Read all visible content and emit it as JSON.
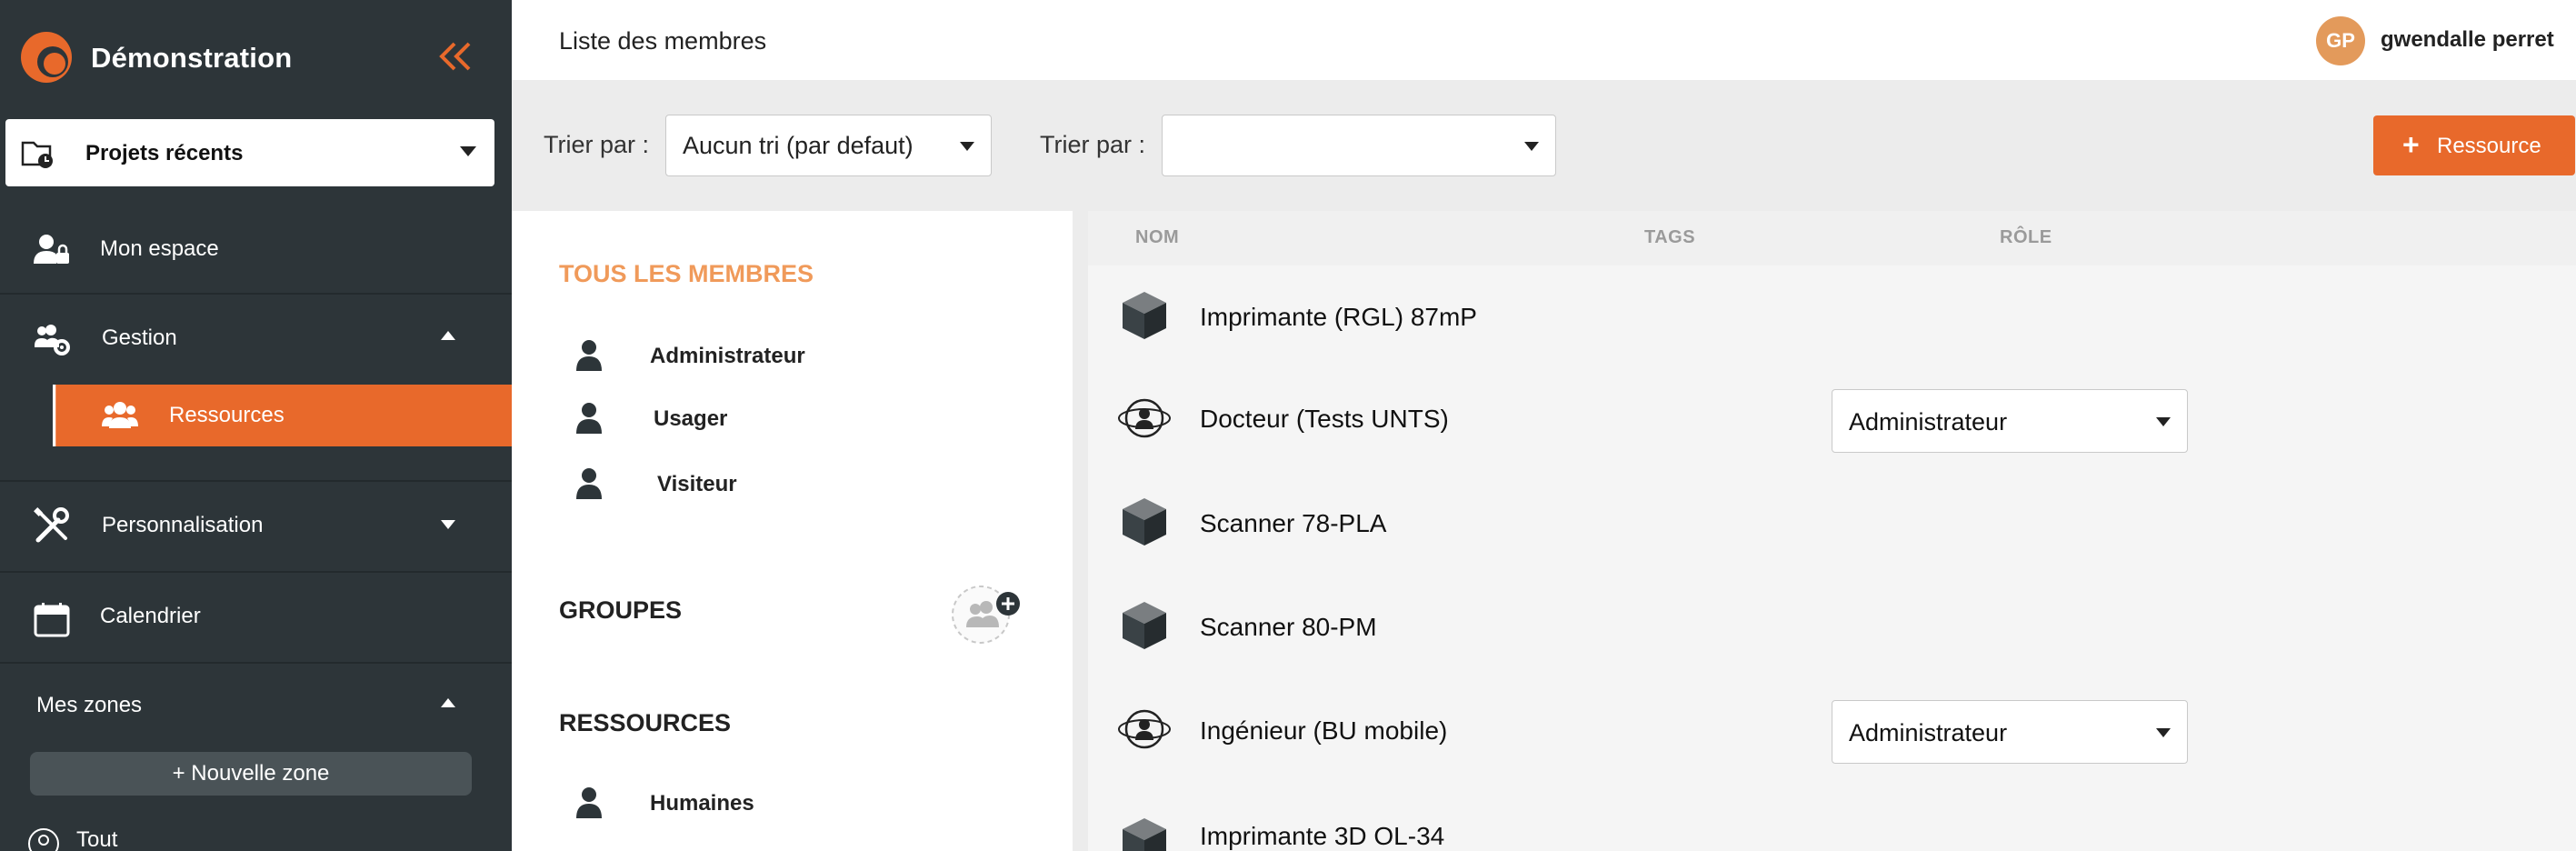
{
  "sidebar": {
    "brand": "Démonstration",
    "recent_projects": "Projets récents",
    "items": {
      "mon_espace": "Mon espace",
      "gestion": "Gestion",
      "ressources": "Ressources",
      "personnalisation": "Personnalisation",
      "calendrier": "Calendrier",
      "mes_zones": "Mes zones",
      "tout": "Tout"
    },
    "new_zone": "+ Nouvelle zone",
    "colors": {
      "bg": "#2d3539",
      "accent": "#e8692b"
    }
  },
  "header": {
    "title": "Liste des membres",
    "user_initials": "GP",
    "user_name": "gwendalle perret"
  },
  "filters": {
    "sort1_label": "Trier par :",
    "sort1_value": "Aucun tri (par defaut)",
    "sort2_label": "Trier par :",
    "sort2_value": "",
    "add_button": "Ressource"
  },
  "members_panel": {
    "all_members": "TOUS LES MEMBRES",
    "roles": [
      "Administrateur",
      "Usager",
      "Visiteur"
    ],
    "groups_title": "GROUPES",
    "resources_title": "RESSOURCES",
    "resource_types": [
      "Humaines"
    ]
  },
  "table": {
    "headers": {
      "name": "NOM",
      "tags": "TAGS",
      "role": "RÔLE"
    },
    "rows": [
      {
        "name": "Imprimante (RGL) 87mP",
        "icon": "cube-icon",
        "role": ""
      },
      {
        "name": "Docteur (Tests UNTS)",
        "icon": "human-resource-icon",
        "role": "Administrateur"
      },
      {
        "name": "Scanner 78-PLA",
        "icon": "cube-icon",
        "role": ""
      },
      {
        "name": "Scanner 80-PM",
        "icon": "cube-icon",
        "role": ""
      },
      {
        "name": "Ingénieur (BU mobile)",
        "icon": "human-resource-icon",
        "role": "Administrateur"
      },
      {
        "name": "Imprimante 3D OL-34",
        "icon": "cube-icon",
        "role": ""
      }
    ]
  }
}
